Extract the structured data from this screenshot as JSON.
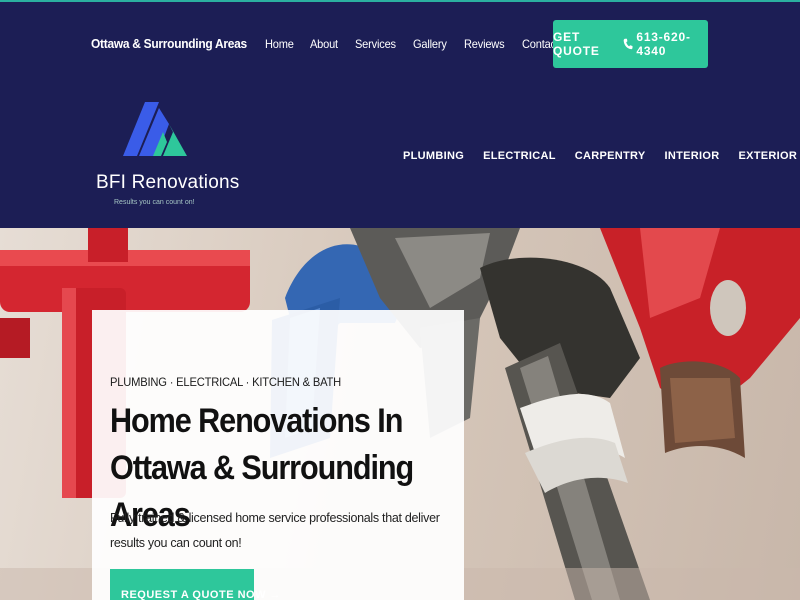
{
  "header": {
    "region": "Ottawa & Surrounding Areas",
    "nav": [
      "Home",
      "About",
      "Services",
      "Gallery",
      "Reviews",
      "Contact"
    ],
    "quote_label": "GET QUOTE",
    "phone": "613-620-4340"
  },
  "logo": {
    "name": "BFI Renovations",
    "tagline": "Results you can count on!",
    "colors": {
      "blue": "#3a5ce8",
      "green": "#2ec79b"
    }
  },
  "categories": [
    "PLUMBING",
    "ELECTRICAL",
    "CARPENTRY",
    "INTERIOR",
    "EXTERIOR"
  ],
  "hero": {
    "eyebrow": "PLUMBING · ELECTRICAL · KITCHEN & BATH",
    "headline": "Home Renovations In Ottawa & Surrounding Areas",
    "description": "Fully trained & licensed home service professionals that deliver results you can count on!",
    "cta": "REQUEST A QUOTE NOW →"
  },
  "colors": {
    "header_bg": "#1c1e55",
    "accent": "#2ec79b"
  }
}
